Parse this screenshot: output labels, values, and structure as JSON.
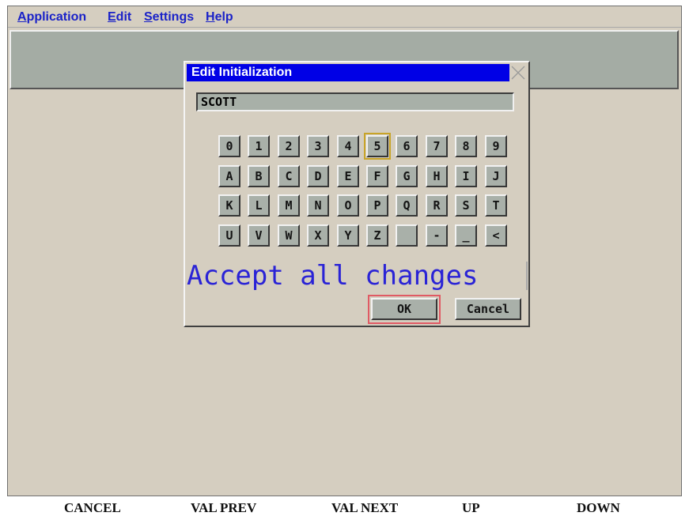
{
  "menu": {
    "items": [
      {
        "label_acc": "A",
        "label_rest": "pplication"
      },
      {
        "label_acc": "E",
        "label_rest": "dit"
      },
      {
        "label_acc": "S",
        "label_rest": "ettings"
      },
      {
        "label_acc": "H",
        "label_rest": "elp"
      }
    ]
  },
  "dialog": {
    "title": "Edit Initialization",
    "field_value": "SCOTT",
    "keys": [
      [
        "0",
        "1",
        "2",
        "3",
        "4",
        "5",
        "6",
        "7",
        "8",
        "9"
      ],
      [
        "A",
        "B",
        "C",
        "D",
        "E",
        "F",
        "G",
        "H",
        "I",
        "J"
      ],
      [
        "K",
        "L",
        "M",
        "N",
        "O",
        "P",
        "Q",
        "R",
        "S",
        "T"
      ],
      [
        "U",
        "V",
        "W",
        "X",
        "Y",
        "Z",
        " ",
        "-",
        "_",
        "<"
      ]
    ],
    "focused_key": "5",
    "message": "Accept all changes",
    "ok_label": "OK",
    "cancel_label": "Cancel"
  },
  "statusbar": {
    "cancel": "CANCEL",
    "val_prev": "VAL PREV",
    "val_next": "VAL NEXT",
    "up": "UP",
    "down": "DOWN"
  },
  "colors": {
    "menu_text": "#1a22c8",
    "titlebar": "#0000e6",
    "message": "#2a23d6",
    "ok_highlight": "#e05a64"
  }
}
